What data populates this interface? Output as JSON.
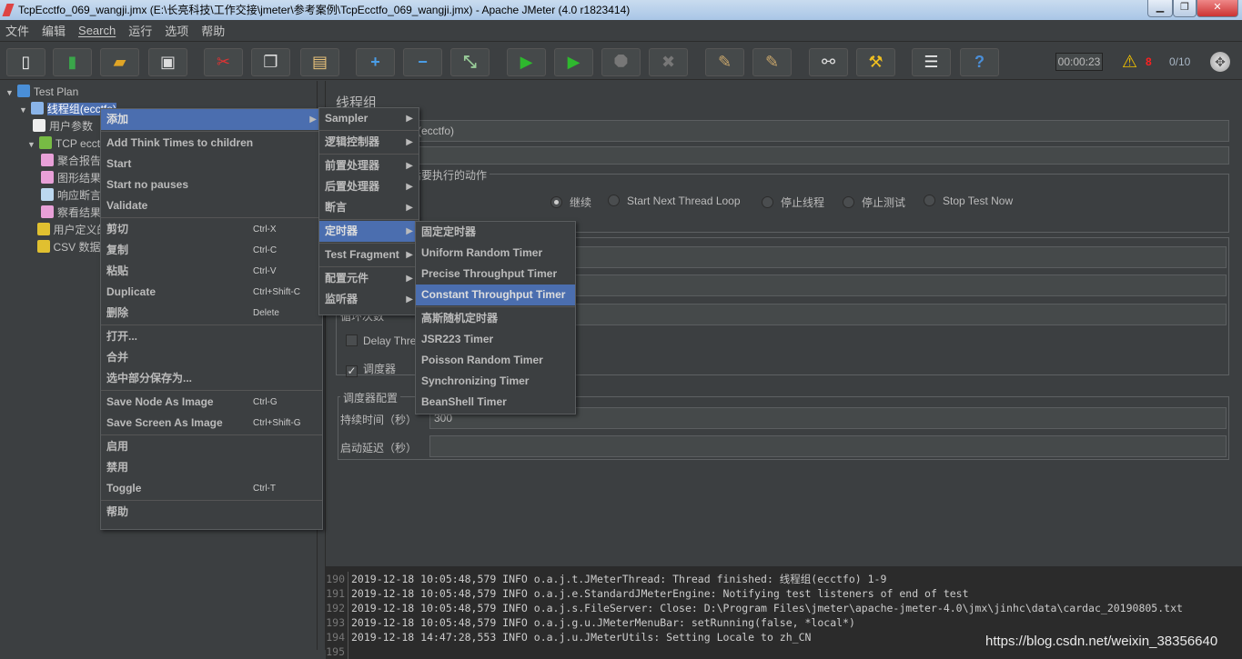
{
  "window": {
    "title": "TcpEcctfo_069_wangji.jmx (E:\\长亮科技\\工作交接\\jmeter\\参考案例\\TcpEcctfo_069_wangji.jmx) - Apache JMeter (4.0 r1823414)"
  },
  "menubar": [
    "文件",
    "编辑",
    "Search",
    "运行",
    "选项",
    "帮助"
  ],
  "toolbar": {
    "buttons": [
      {
        "name": "new",
        "icon": "new-file-icon",
        "glyph": "▯",
        "color": "#f5f5f5"
      },
      {
        "name": "templates",
        "icon": "templates-icon",
        "glyph": "▮",
        "color": "#3aa64a"
      },
      {
        "name": "open",
        "icon": "folder-open-icon",
        "glyph": "▰",
        "color": "#e0a526"
      },
      {
        "name": "save",
        "icon": "save-icon",
        "glyph": "▣",
        "color": "#dddddd"
      },
      {
        "name": "cut",
        "icon": "cut-icon",
        "glyph": "✂",
        "color": "#d33"
      },
      {
        "name": "copy",
        "icon": "copy-icon",
        "glyph": "❐",
        "color": "#ddd"
      },
      {
        "name": "paste",
        "icon": "paste-icon",
        "glyph": "▤",
        "color": "#e7c17a"
      },
      {
        "name": "expand",
        "icon": "plus-icon",
        "glyph": "+",
        "color": "#4a9ee8"
      },
      {
        "name": "collapse",
        "icon": "minus-icon",
        "glyph": "−",
        "color": "#4a9ee8"
      },
      {
        "name": "toggle",
        "icon": "toggle-icon",
        "glyph": "⤡",
        "color": "#9c9"
      },
      {
        "name": "start",
        "icon": "play-icon",
        "glyph": "▶",
        "color": "#2eb82e"
      },
      {
        "name": "start-no-pauses",
        "icon": "play-no-pause-icon",
        "glyph": "▶",
        "color": "#2eb82e"
      },
      {
        "name": "stop",
        "icon": "stop-icon",
        "glyph": "⯃",
        "color": "#777"
      },
      {
        "name": "shutdown",
        "icon": "shutdown-icon",
        "glyph": "✖",
        "color": "#777"
      },
      {
        "name": "clear",
        "icon": "clear-icon",
        "glyph": "✎",
        "color": "#c9a66b"
      },
      {
        "name": "clear-all",
        "icon": "clear-all-icon",
        "glyph": "✎",
        "color": "#c9a66b"
      },
      {
        "name": "search",
        "icon": "binoculars-icon",
        "glyph": "⚯",
        "color": "#ddd"
      },
      {
        "name": "reset-search",
        "icon": "broom-icon",
        "glyph": "⚒",
        "color": "#f0c020"
      },
      {
        "name": "function-helper",
        "icon": "list-icon",
        "glyph": "☰",
        "color": "#eee"
      },
      {
        "name": "help",
        "icon": "help-icon",
        "glyph": "?",
        "color": "#4a8fd8"
      }
    ],
    "timer": "00:00:23",
    "warning_count": "8",
    "threads": "0/10",
    "warning_color": "#ff2020"
  },
  "tree": [
    {
      "label": "Test Plan",
      "icon": "test-plan-icon",
      "color": "#4a8fd8",
      "indent": 0,
      "expander": "▼"
    },
    {
      "label": "线程组(ecctfo)",
      "icon": "thread-group-gear-icon",
      "color": "#8ab4e8",
      "indent": 1,
      "expander": "▼",
      "selected": true
    },
    {
      "label": "用户参数",
      "icon": "user-params-icon",
      "color": "#eeeeee",
      "indent": 2,
      "expander": ""
    },
    {
      "label": "TCP ecctfo",
      "icon": "sampler-pipette-icon",
      "color": "#77bb44",
      "indent": 1.6,
      "expander": "▼"
    },
    {
      "label": "聚合报告",
      "icon": "listener-chart-icon",
      "color": "#e8a0d8",
      "indent": 2.6,
      "expander": ""
    },
    {
      "label": "图形结果",
      "icon": "listener-chart-icon",
      "color": "#e8a0d8",
      "indent": 2.6,
      "expander": ""
    },
    {
      "label": "响应断言",
      "icon": "assertion-magnifier-icon",
      "color": "#bcd8f0",
      "indent": 2.6,
      "expander": ""
    },
    {
      "label": "察看结果树",
      "icon": "listener-chart-icon",
      "color": "#e8a0d8",
      "indent": 2.6,
      "expander": ""
    },
    {
      "label": "用户定义的变量",
      "icon": "config-tools-icon",
      "color": "#e0c030",
      "indent": 2.3,
      "expander": ""
    },
    {
      "label": "CSV 数据文件设置",
      "icon": "config-tools-icon",
      "color": "#e0c030",
      "indent": 2.3,
      "expander": ""
    }
  ],
  "main": {
    "title": "线程组",
    "name_value": "线程组(ecctfo)",
    "comment_value": "",
    "action_group_label": "在取样器错误后要执行的动作",
    "actions": [
      {
        "label": "继续",
        "selected": true
      },
      {
        "label": "Start Next Thread Loop",
        "selected": false
      },
      {
        "label": "停止线程",
        "selected": false
      },
      {
        "label": "停止测试",
        "selected": false
      },
      {
        "label": "Stop Test Now",
        "selected": false
      }
    ],
    "loop_label": "循环次数",
    "delay_label": "Delay Thread creation until needed",
    "delay_checked": false,
    "scheduler_label": "调度器",
    "scheduler_checked": true,
    "scheduler_config_label": "调度器配置",
    "duration_label": "持续时间（秒）",
    "duration_value": "300",
    "startup_delay_label": "启动延迟（秒）",
    "startup_delay_value": ""
  },
  "context_menu": [
    {
      "label": "添加",
      "submenu": true,
      "highlight": true
    },
    {
      "sep": true
    },
    {
      "label": "Add Think Times to children"
    },
    {
      "label": "Start"
    },
    {
      "label": "Start no pauses"
    },
    {
      "label": "Validate"
    },
    {
      "sep": true
    },
    {
      "label": "剪切",
      "shortcut": "Ctrl-X"
    },
    {
      "label": "复制",
      "shortcut": "Ctrl-C"
    },
    {
      "label": "粘贴",
      "shortcut": "Ctrl-V"
    },
    {
      "label": "Duplicate",
      "shortcut": "Ctrl+Shift-C"
    },
    {
      "label": "删除",
      "shortcut": "Delete"
    },
    {
      "sep": true
    },
    {
      "label": "打开..."
    },
    {
      "label": "合并"
    },
    {
      "label": "选中部分保存为..."
    },
    {
      "sep": true
    },
    {
      "label": "Save Node As Image",
      "shortcut": "Ctrl-G"
    },
    {
      "label": "Save Screen As Image",
      "shortcut": "Ctrl+Shift-G"
    },
    {
      "sep": true
    },
    {
      "label": "启用"
    },
    {
      "label": "禁用"
    },
    {
      "label": "Toggle",
      "shortcut": "Ctrl-T"
    },
    {
      "sep": true
    },
    {
      "label": "帮助"
    }
  ],
  "add_submenu": [
    {
      "label": "Sampler",
      "submenu": true
    },
    {
      "sep": true
    },
    {
      "label": "逻辑控制器",
      "submenu": true
    },
    {
      "sep": true
    },
    {
      "label": "前置处理器",
      "submenu": true
    },
    {
      "label": "后置处理器",
      "submenu": true
    },
    {
      "label": "断言",
      "submenu": true
    },
    {
      "sep": true
    },
    {
      "label": "定时器",
      "submenu": true,
      "highlight": true
    },
    {
      "sep": true
    },
    {
      "label": "Test Fragment",
      "submenu": true
    },
    {
      "sep": true
    },
    {
      "label": "配置元件",
      "submenu": true
    },
    {
      "label": "监听器",
      "submenu": true
    }
  ],
  "timer_submenu": [
    {
      "label": "固定定时器"
    },
    {
      "label": "Uniform Random Timer"
    },
    {
      "label": "Precise Throughput Timer"
    },
    {
      "label": "Constant Throughput Timer",
      "highlight": true
    },
    {
      "sep": true
    },
    {
      "label": "高斯随机定时器"
    },
    {
      "label": "JSR223 Timer"
    },
    {
      "label": "Poisson Random Timer"
    },
    {
      "label": "Synchronizing Timer"
    },
    {
      "label": "BeanShell Timer"
    }
  ],
  "log": [
    {
      "n": "190",
      "text": "2019-12-18 10:05:48,579 INFO o.a.j.t.JMeterThread: Thread finished: 线程组(ecctfo) 1-9"
    },
    {
      "n": "191",
      "text": "2019-12-18 10:05:48,579 INFO o.a.j.e.StandardJMeterEngine: Notifying test listeners of end of test"
    },
    {
      "n": "192",
      "text": "2019-12-18 10:05:48,579 INFO o.a.j.s.FileServer: Close: D:\\Program Files\\jmeter\\apache-jmeter-4.0\\jmx\\jinhc\\data\\cardac_20190805.txt"
    },
    {
      "n": "193",
      "text": "2019-12-18 10:05:48,579 INFO o.a.j.g.u.JMeterMenuBar: setRunning(false, *local*)"
    },
    {
      "n": "194",
      "text": "2019-12-18 14:47:28,553 INFO o.a.j.u.JMeterUtils: Setting Locale to zh_CN"
    },
    {
      "n": "195",
      "text": ""
    }
  ],
  "watermark": "https://blog.csdn.net/weixin_38356640"
}
